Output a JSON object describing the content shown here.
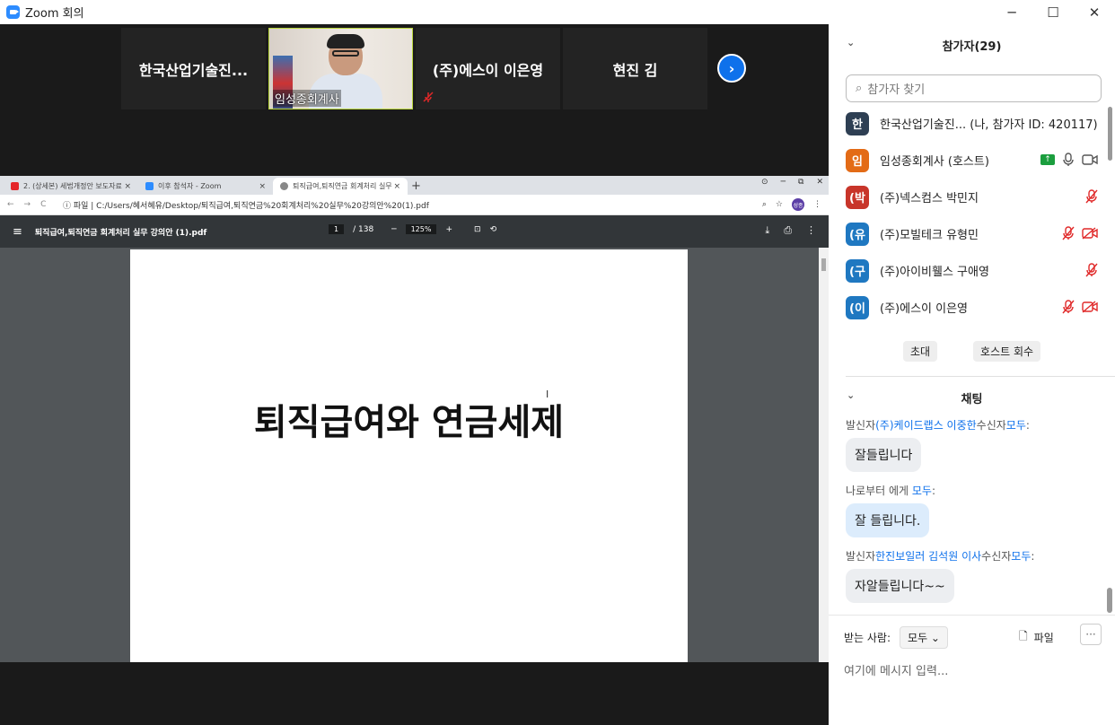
{
  "window": {
    "title": "Zoom 회의",
    "minimize": "─",
    "maximize": "☐",
    "close": "✕"
  },
  "thumbnails": [
    {
      "name": "한국산업기술진..."
    },
    {
      "name": "임성종회계사"
    },
    {
      "name": "(주)에스이 이은영"
    },
    {
      "name": "현진 김"
    }
  ],
  "next_arrow": "›",
  "browser": {
    "tabs": [
      {
        "label": "2. (상세본) 세법개정안 보도자료",
        "color": "#e52629"
      },
      {
        "label": "이후 참석자 - Zoom",
        "color": "#2d8cff"
      },
      {
        "label": "퇴직급여,퇴직연금 회계처리 실무",
        "color": "#888888"
      }
    ],
    "tab_close": "×",
    "new_tab": "+",
    "win_controls": [
      "⊙",
      "─",
      "⧉",
      "✕"
    ],
    "nav": [
      "←",
      "→",
      "C"
    ],
    "url": "ⓘ 파일 | C:/Users/혜서혜유/Desktop/퇴직급여,퇴직연금%20회계처리%20실무%20강의안%20(1).pdf",
    "profile": "성종",
    "icons": [
      "⌕",
      "☆",
      "⋮"
    ]
  },
  "pdf": {
    "menu": "≡",
    "title": "퇴직급여,퇴직연금 회계처리 실무 강의안 (1).pdf",
    "page": "1",
    "total": "/ 138",
    "zoom_out": "─",
    "zoom": "125%",
    "zoom_in": "+",
    "fit": "⊡",
    "rotate": "⟲",
    "download": "⤓",
    "print": "⎙",
    "more": "⋮",
    "heading": "퇴직급여와 연금세제",
    "cursor": "I"
  },
  "participants": {
    "header": "참가자(29)",
    "chevron": "⌄",
    "search_icon": "⌕",
    "search_placeholder": "참가자 찾기",
    "list": [
      {
        "initial": "한",
        "name": "한국산업기술진...  (나, 참가자 ID: 420117)",
        "color": "#2e3f53"
      },
      {
        "initial": "임",
        "name": "임성종회계사 (호스트)",
        "color": "#e36b16"
      },
      {
        "initial": "(박",
        "name": "(주)넥스컴스 박민지",
        "color": "#c8352a"
      },
      {
        "initial": "(유",
        "name": "(주)모빌테크 유형민",
        "color": "#1f78c1"
      },
      {
        "initial": "(구",
        "name": "(주)아이비휄스 구애영",
        "color": "#1f78c1"
      },
      {
        "initial": "(이",
        "name": "(주)에스이 이은영",
        "color": "#1f78c1"
      }
    ],
    "share_icon": "↑",
    "invite": "초대",
    "reclaim_host": "호스트 회수"
  },
  "chat": {
    "header": "채팅",
    "messages": [
      {
        "meta_pre": "발신자",
        "sender": "(주)케이드랩스 이중한",
        "meta_mid": "수신자",
        "to": "모두",
        "text": "잘들립니다",
        "me": false
      },
      {
        "meta_pre": "나로부터 에게 ",
        "sender": "",
        "meta_mid": "",
        "to": "모두",
        "text": "잘 들립니다.",
        "me": true
      },
      {
        "meta_pre": "발신자",
        "sender": "한진보일러 김석원 이사",
        "meta_mid": "수신자",
        "to": "모두",
        "text": "자알들립니다~~",
        "me": false
      }
    ],
    "to_label": "받는 사람:",
    "to_value": "모두 ⌄",
    "file_icon": "🗋",
    "file_label": "파일",
    "more": "···",
    "input_placeholder": "여기에 메시지 입력..."
  }
}
